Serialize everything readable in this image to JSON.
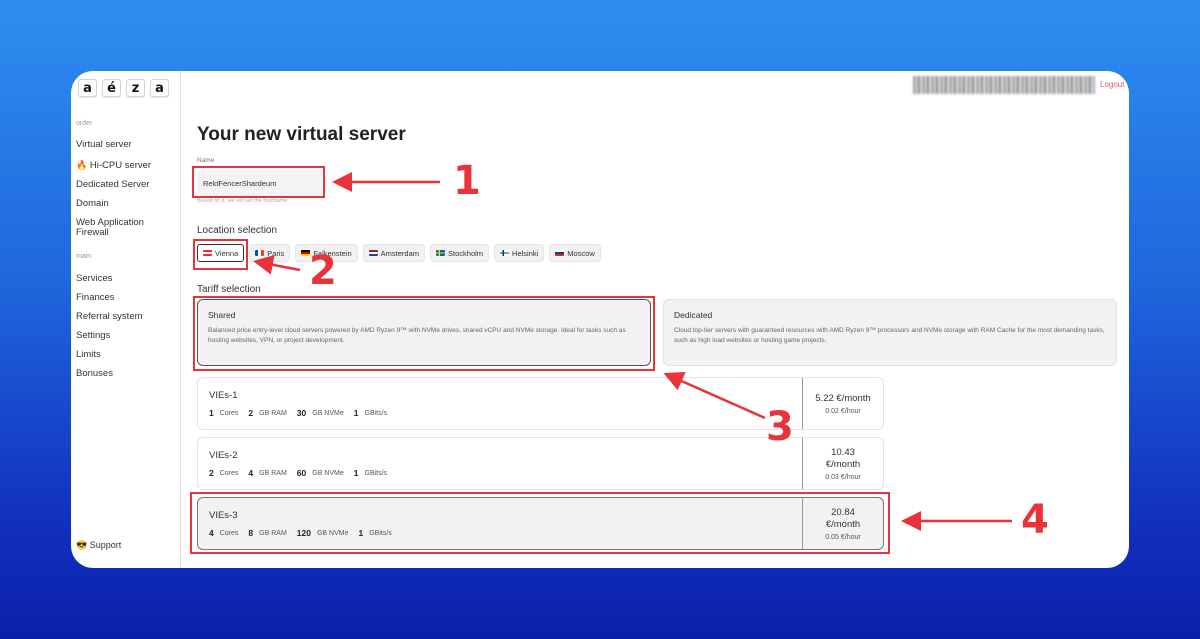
{
  "logo": [
    "a",
    "é",
    "z",
    "a"
  ],
  "sidebar": {
    "order_label": "order",
    "order_items": [
      "Virtual server",
      "Hi-CPU server",
      "Dedicated Server",
      "Domain",
      "Web Application Firewall"
    ],
    "main_label": "main",
    "main_items": [
      "Services",
      "Finances",
      "Referral system",
      "Settings",
      "Limits",
      "Bonuses"
    ],
    "support": "Support"
  },
  "topbar": {
    "logout": "Logout"
  },
  "page": {
    "title": "Your new virtual server",
    "name_label": "Name",
    "name_value": "RektFencerShardeum",
    "name_hint": "Based on it, we will set the hostname",
    "location_title": "Location selection",
    "tariff_title": "Tariff selection"
  },
  "locations": [
    {
      "label": "Vienna",
      "flag": "austria",
      "active": true
    },
    {
      "label": "Paris",
      "flag": "france",
      "active": false
    },
    {
      "label": "Falkenstein",
      "flag": "germany",
      "active": false
    },
    {
      "label": "Amsterdam",
      "flag": "netherlands",
      "active": false
    },
    {
      "label": "Stockholm",
      "flag": "sweden",
      "active": false
    },
    {
      "label": "Helsinki",
      "flag": "finland",
      "active": false
    },
    {
      "label": "Moscow",
      "flag": "russia",
      "active": false
    }
  ],
  "tariffs": [
    {
      "name": "Shared",
      "desc": "Balanced price entry-level cloud servers powered by AMD Ryzen 9™ with NVMe drives, shared vCPU and NVMe storage. Ideal for tasks such as hosting websites, VPN, or project development.",
      "active": true
    },
    {
      "name": "Dedicated",
      "desc": "Cloud top-tier servers with guaranteed resources with AMD Ryzen 9™ processors and NVMe storage with RAM Cache for the most demanding tasks, such as high load websites or hosting game projects.",
      "active": false
    }
  ],
  "plans": [
    {
      "name": "VIEs-1",
      "cores": "1",
      "cores_unit": "Cores",
      "ram": "2",
      "ram_unit": "GB RAM",
      "nvme": "30",
      "nvme_unit": "GB NVMe",
      "net": "1",
      "net_unit": "GBits/s",
      "price": "5.22 €/month",
      "hour": "0.02 €/hour",
      "active": false
    },
    {
      "name": "VIEs-2",
      "cores": "2",
      "cores_unit": "Cores",
      "ram": "4",
      "ram_unit": "GB RAM",
      "nvme": "60",
      "nvme_unit": "GB NVMe",
      "net": "1",
      "net_unit": "GBits/s",
      "price": "10.43 €/month",
      "hour": "0.03 €/hour",
      "active": false
    },
    {
      "name": "VIEs-3",
      "cores": "4",
      "cores_unit": "Cores",
      "ram": "8",
      "ram_unit": "GB RAM",
      "nvme": "120",
      "nvme_unit": "GB NVMe",
      "net": "1",
      "net_unit": "GBits/s",
      "price": "20.84 €/month",
      "hour": "0.05 €/hour",
      "active": true
    }
  ],
  "annotations": [
    "1",
    "2",
    "3",
    "4"
  ],
  "colors": {
    "annotation": "#e8333a",
    "background_top": "#2e8ef0",
    "background_bottom": "#0b1fa8",
    "logout": "#e05a6a"
  }
}
